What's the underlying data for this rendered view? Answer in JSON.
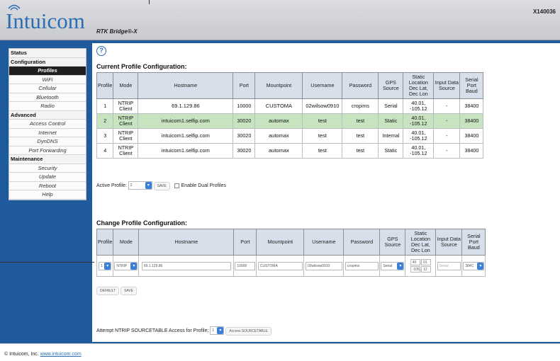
{
  "header": {
    "logo": "Intuicom",
    "product": "RTK Bridge®-X",
    "serial": "X140036"
  },
  "sidebar": [
    {
      "type": "section",
      "label": "Status"
    },
    {
      "type": "section",
      "label": "Configuration"
    },
    {
      "type": "item",
      "label": "Profiles",
      "active": true
    },
    {
      "type": "item",
      "label": "WiFi"
    },
    {
      "type": "item",
      "label": "Cellular"
    },
    {
      "type": "item",
      "label": "Bluetooth"
    },
    {
      "type": "item",
      "label": "Radio"
    },
    {
      "type": "section",
      "label": "Advanced"
    },
    {
      "type": "item",
      "label": "Access Control"
    },
    {
      "type": "item",
      "label": "Internet"
    },
    {
      "type": "item",
      "label": "DynDNS"
    },
    {
      "type": "item",
      "label": "Port Forwarding"
    },
    {
      "type": "section",
      "label": "Maintenance"
    },
    {
      "type": "item",
      "label": "Security"
    },
    {
      "type": "item",
      "label": "Update"
    },
    {
      "type": "item",
      "label": "Reboot"
    },
    {
      "type": "item",
      "label": "Help"
    }
  ],
  "help_icon": "question-circle-icon",
  "current": {
    "title": "Current Profile Configuration:",
    "headers": [
      "Profile",
      "Mode",
      "Hostname",
      "Port",
      "Mountpoint",
      "Username",
      "Password",
      "GPS Source",
      "Static Location Dec Lat, Dec Lon",
      "Input Data Source",
      "Serial Port Baud"
    ],
    "rows": [
      {
        "cells": [
          "1",
          "NTRIP Client",
          "69.1.129.86",
          "10000",
          "CUSTOMA",
          "02wilsow0910",
          "cropims",
          "Serial",
          "40.01, -105.12",
          "-",
          "38400"
        ],
        "selected": false
      },
      {
        "cells": [
          "2",
          "NTRIP Client",
          "intuicom1.selfip.com",
          "30020",
          "automax",
          "test",
          "test",
          "Static",
          "40.01, -105.12",
          "-",
          "38400"
        ],
        "selected": true
      },
      {
        "cells": [
          "3",
          "NTRIP Client",
          "intuicom1.selfip.com",
          "30020",
          "automax",
          "test",
          "test",
          "Internal",
          "40.01, -105.12",
          "-",
          "38400"
        ],
        "selected": false
      },
      {
        "cells": [
          "4",
          "NTRIP Client",
          "intuicom1.selfip.com",
          "30020",
          "automax",
          "test",
          "test",
          "Static",
          "40.01, -105.12",
          "-",
          "38400"
        ],
        "selected": false
      }
    ]
  },
  "active_profile": {
    "label": "Active Profile:",
    "value": "2",
    "save_label": "SAVE",
    "dual_label": "Enable Dual Profiles"
  },
  "change": {
    "title": "Change Profile Configuration:",
    "headers": [
      "Profile",
      "Mode",
      "Hostname",
      "Port",
      "Mountpoint",
      "Username",
      "Password",
      "GPS Source",
      "Static Location Dec Lat, Dec Lon",
      "Input Data Source",
      "Serial Port Baud"
    ],
    "profile": "1",
    "mode": "NTRIP",
    "hostname": "69.1.129.86",
    "port": "10000",
    "mountpoint": "CUSTOMA",
    "username": "02wilsow0910",
    "password": "cropims",
    "gps_source": "Serial",
    "lat": "40",
    "lat_min": "01",
    "lon": "-105",
    "lon_min": "12",
    "input_source": "Serial",
    "baud": "384C",
    "default_label": "DEFAULT",
    "save_label": "SAVE"
  },
  "sourcetable": {
    "label": "Attempt NTRIP SOURCETABLE Access for Profile:",
    "value": "1",
    "button": "Access SOURCETABLE"
  },
  "footer": {
    "text": "© Intuicom, Inc.",
    "link": "www.intuicom.com"
  }
}
